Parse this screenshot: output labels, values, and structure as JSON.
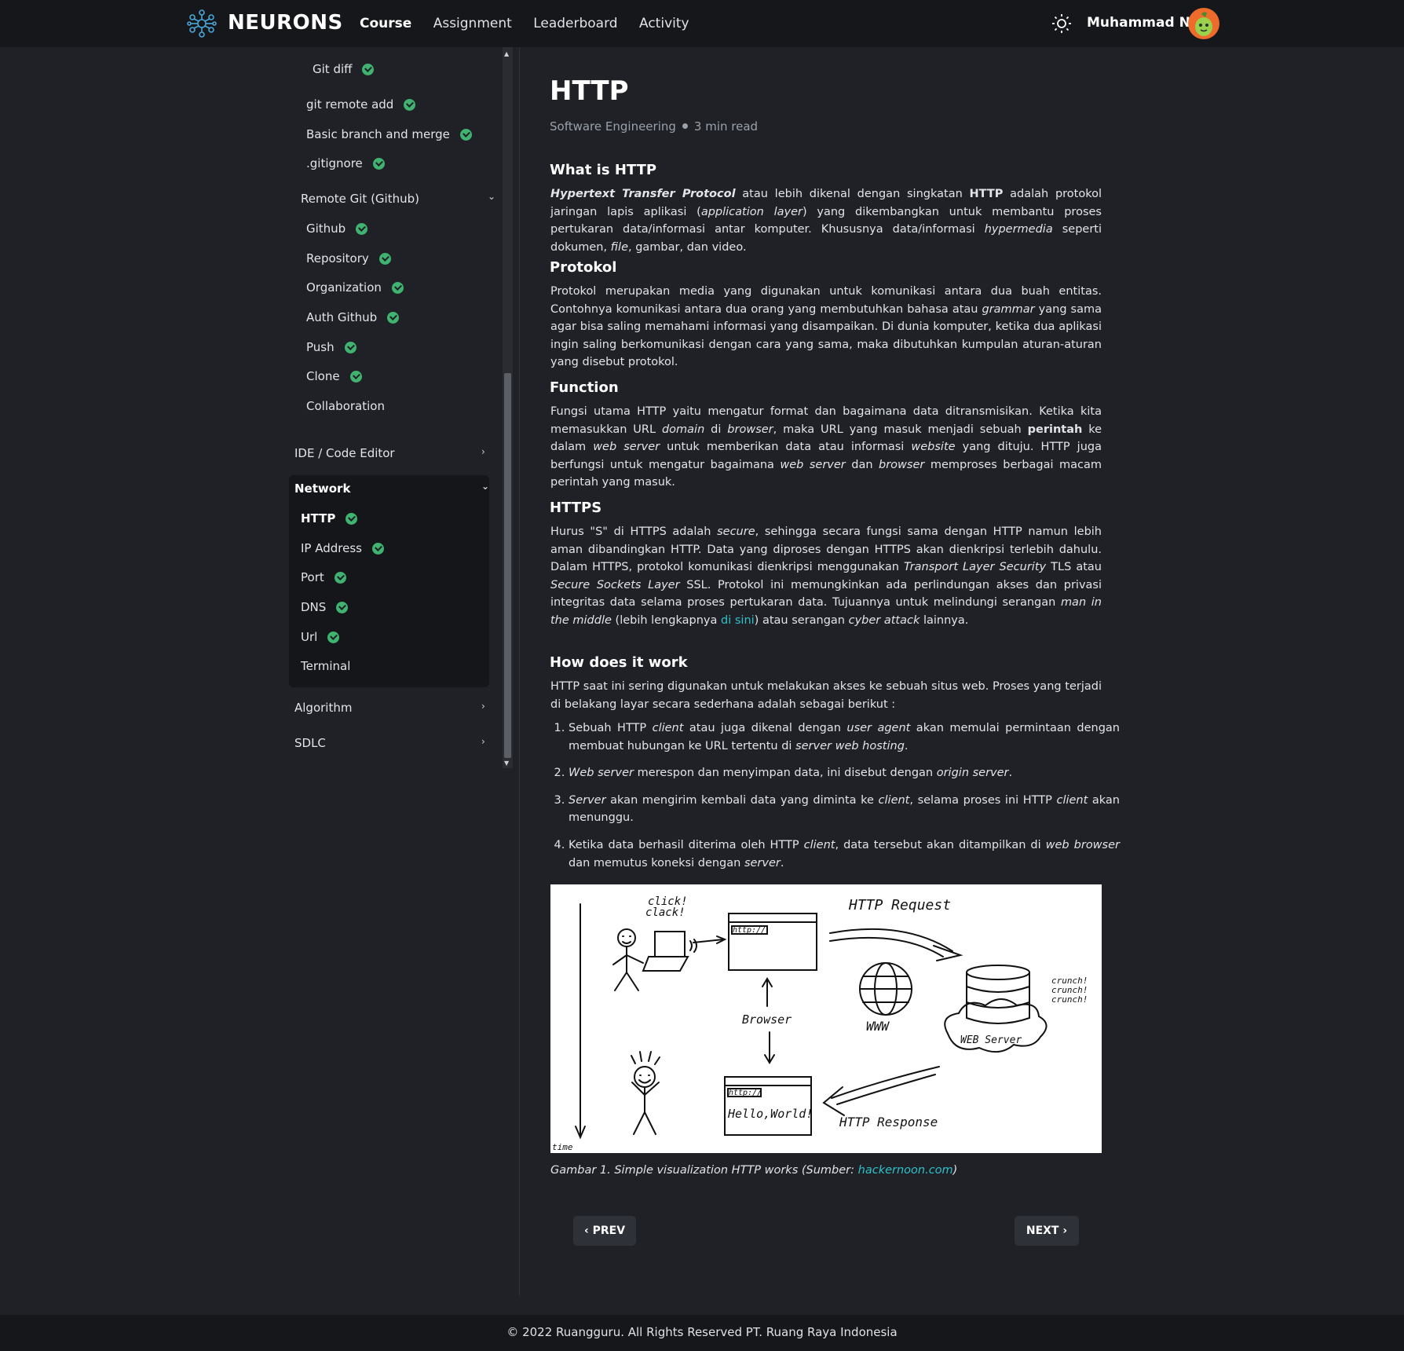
{
  "header": {
    "brand": "NEURONS",
    "nav": [
      "Course",
      "Assignment",
      "Leaderboard",
      "Activity"
    ],
    "active_nav": "Course",
    "username": "Muhammad N",
    "theme_icon": "sun-icon",
    "logo_icon": "neuron-logo-icon"
  },
  "sidebar": {
    "git_items": [
      "Git diff",
      "git remote add",
      "Basic branch and merge",
      ".gitignore"
    ],
    "remote_git": {
      "title": "Remote Git (Github)",
      "items": [
        "Github",
        "Repository",
        "Organization",
        "Auth Github",
        "Push",
        "Clone",
        "Collaboration"
      ]
    },
    "ide": "IDE / Code Editor",
    "network": {
      "title": "Network",
      "items": [
        "HTTP",
        "IP Address",
        "Port",
        "DNS",
        "Url",
        "Terminal"
      ]
    },
    "algorithm": "Algorithm",
    "sdlc": "SDLC"
  },
  "article": {
    "title": "HTTP",
    "category": "Software Engineering",
    "read_time": "3 min read",
    "h_what": "What is HTTP",
    "h_protokol": "Protokol",
    "h_function": "Function",
    "h_https": "HTTPS",
    "h_how": "How does it work",
    "how_intro": "HTTP saat ini sering digunakan untuk melakukan akses ke sebuah situs web. Proses yang terjadi di belakang layar secara sederhana adalah sebagai berikut :",
    "https_link": "di sini",
    "caption_prefix": "Gambar 1. Simple visualization HTTP works (Sumber: ",
    "caption_link": "hackernoon.com",
    "caption_suffix": ")"
  },
  "figure_labels": {
    "click": "click!",
    "clack": "clack!",
    "request": "HTTP Request",
    "url": "http://",
    "browser": "Browser",
    "www": "WWW",
    "crunch": "crunch!",
    "server": "WEB Server",
    "hello": "Hello,World!",
    "response": "HTTP Response",
    "time": "time"
  },
  "pager": {
    "prev": "‹ PREV",
    "next": "NEXT ›"
  },
  "footer": "© 2022 Ruangguru. All Rights Reserved PT. Ruang Raya Indonesia",
  "colors": {
    "accent": "#2fc1c9",
    "check": "#3fb36f",
    "bg": "#1f2127",
    "topbar": "#15171b"
  }
}
